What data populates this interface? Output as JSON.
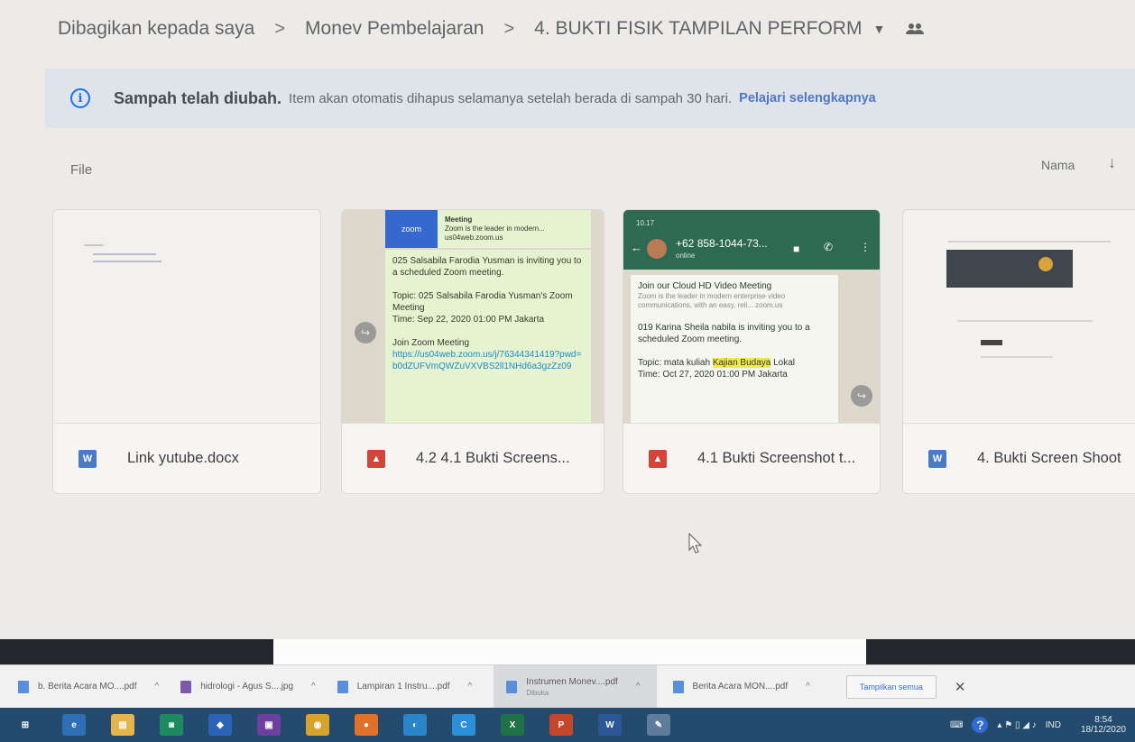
{
  "breadcrumb": {
    "items": [
      "Dibagikan kepada saya",
      "Monev Pembelajaran",
      "4. BUKTI FISIK TAMPILAN PERFORM"
    ],
    "separator": ">"
  },
  "banner": {
    "title": "Sampah telah diubah.",
    "message": "Item akan otomatis dihapus selamanya setelah berada di sampah 30 hari.",
    "link": "Pelajari selengkapnya"
  },
  "files_section": {
    "label": "File",
    "sort_label": "Nama",
    "sort_arrow": "↓"
  },
  "files": [
    {
      "name": "Link yutube.docx",
      "type": "word",
      "icon_letter": "W"
    },
    {
      "name": "4.2 4.1 Bukti Screens...",
      "type": "image",
      "icon_letter": "▲"
    },
    {
      "name": "4.1 Bukti Screenshot t...",
      "type": "image",
      "icon_letter": "▲"
    },
    {
      "name": "4. Bukti Screen Shoot",
      "type": "word",
      "icon_letter": "W"
    }
  ],
  "preview_zoom": {
    "zoom_label": "zoom",
    "meeting_title": "Meeting",
    "meeting_sub": "Zoom is the leader in modern... us04web.zoom.us",
    "invite": "025 Salsabila Farodia Yusman is inviting you to a scheduled Zoom meeting.",
    "topic": "Topic: 025 Salsabila Farodia Yusman's Zoom Meeting",
    "time": "Time: Sep 22, 2020 01:00 PM Jakarta",
    "join": "Join Zoom Meeting",
    "link": "https://us04web.zoom.us/j/76344341419?pwd=b0dZUFVmQWZuVXVBS2ll1NHd6a3gzZz09"
  },
  "preview_whatsapp": {
    "status_time": "10.17",
    "number": "+62 858-1044-73...",
    "status": "online",
    "join_title": "Join our Cloud HD Video Meeting",
    "join_sub": "Zoom is the leader in modern enterprise video communications, with an easy, reli... zoom.us",
    "invite": "019 Karina Sheila nabila is inviting you to a scheduled Zoom meeting.",
    "topic_prefix": "Topic: mata kuliah ",
    "topic_highlight": "Kajian Budaya",
    "topic_suffix": " Lokal",
    "time": "Time: Oct 27, 2020 01:00 PM Jakarta"
  },
  "downloads": {
    "items": [
      {
        "name": "b. Berita Acara MO....pdf",
        "type": "pdf",
        "sub": ""
      },
      {
        "name": "hidrologi - Agus S....jpg",
        "type": "jpg",
        "sub": ""
      },
      {
        "name": "Lampiran 1 Instru....pdf",
        "type": "pdf",
        "sub": ""
      },
      {
        "name": "Instrumen Monev....pdf",
        "type": "pdf",
        "sub": "Dibuka"
      },
      {
        "name": "Berita Acara MON....pdf",
        "type": "pdf",
        "sub": ""
      }
    ],
    "show_all": "Tampilkan semua",
    "close": "✕"
  },
  "taskbar": {
    "apps": [
      {
        "name": "windows-start",
        "glyph": "⊞",
        "color": "#244a6e"
      },
      {
        "name": "internet-explorer",
        "glyph": "e",
        "color": "#2e6fb5"
      },
      {
        "name": "file-explorer",
        "glyph": "▤",
        "color": "#e3b54a"
      },
      {
        "name": "store",
        "glyph": "◙",
        "color": "#1e8a5f"
      },
      {
        "name": "app-blue",
        "glyph": "◆",
        "color": "#2b63b8"
      },
      {
        "name": "app-photo",
        "glyph": "▣",
        "color": "#6d3f9e"
      },
      {
        "name": "chrome",
        "glyph": "◉",
        "color": "#d8a32d"
      },
      {
        "name": "firefox",
        "glyph": "●",
        "color": "#e0702a"
      },
      {
        "name": "edge",
        "glyph": "◐",
        "color": "#2b86c9"
      },
      {
        "name": "app-c",
        "glyph": "C",
        "color": "#2b90d9"
      },
      {
        "name": "excel",
        "glyph": "X",
        "color": "#1f7244"
      },
      {
        "name": "powerpoint",
        "glyph": "P",
        "color": "#c4472b"
      },
      {
        "name": "word",
        "glyph": "W",
        "color": "#2b5797"
      },
      {
        "name": "paint",
        "glyph": "✎",
        "color": "#5e7d9a"
      }
    ],
    "tray": {
      "lang": "IND",
      "time": "8:54",
      "date": "18/12/2020"
    }
  }
}
